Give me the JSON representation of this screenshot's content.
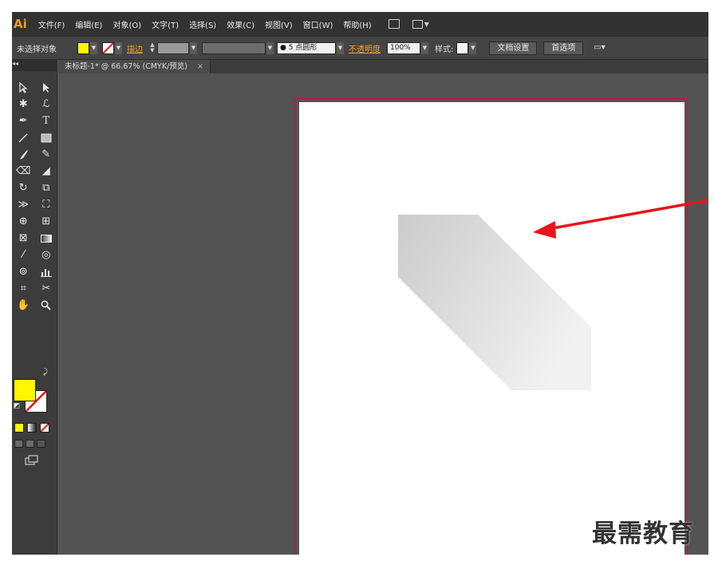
{
  "app": {
    "logo": "Ai"
  },
  "menu": [
    "文件(F)",
    "编辑(E)",
    "对象(O)",
    "文字(T)",
    "选择(S)",
    "效果(C)",
    "视图(V)",
    "窗口(W)",
    "帮助(H)"
  ],
  "control_bar": {
    "selection_status": "未选择对象",
    "fill_color": "#fff700",
    "stroke_label": "描边",
    "brush_label": "5 点圆形",
    "opacity_label": "不透明度",
    "opacity_value": "100%",
    "style_label": "样式:",
    "doc_setup_button": "文档设置",
    "preferences_button": "首选项"
  },
  "document_tab": {
    "title": "未标题-1* @ 66.67% (CMYK/预览)",
    "close": "×"
  },
  "colors": {
    "accent_red": "#e8141b",
    "artboard_border": "#c8102e",
    "fill": "#fff700"
  },
  "watermark": "最需教育"
}
